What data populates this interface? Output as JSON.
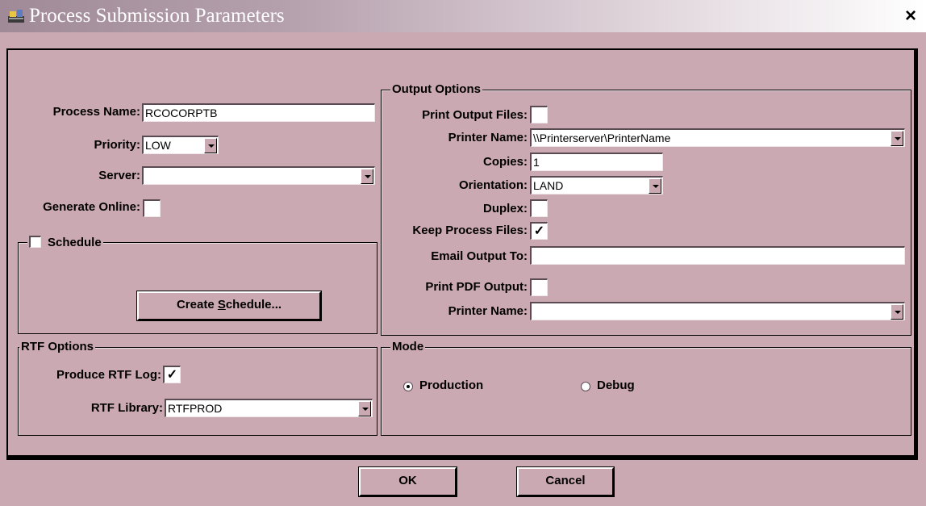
{
  "window": {
    "title": "Process Submission Parameters",
    "close_glyph": "×"
  },
  "process": {
    "name_label": "Process Name:",
    "name_value": "RCOCORPTB",
    "priority_label": "Priority:",
    "priority_value": "LOW",
    "server_label": "Server:",
    "server_value": "",
    "generate_online_label": "Generate Online:",
    "generate_online_checked": false
  },
  "schedule": {
    "label": "Schedule",
    "checked": false,
    "button_prefix": "Create ",
    "button_underline": "S",
    "button_suffix": "chedule..."
  },
  "rtf": {
    "group_title": "RTF Options",
    "log_label": "Produce RTF Log:",
    "log_mark": "✓",
    "library_label": "RTF Library:",
    "library_value": "RTFPROD"
  },
  "output": {
    "group_title": "Output Options",
    "print_files_label": "Print Output Files:",
    "print_files_mark": "",
    "printer_label": "Printer Name:",
    "printer_value": "\\\\Printerserver\\PrinterName",
    "copies_label": "Copies:",
    "copies_value": "1",
    "orientation_label": "Orientation:",
    "orientation_value": "LAND",
    "duplex_label": "Duplex:",
    "duplex_mark": "",
    "keep_files_label": "Keep Process Files:",
    "keep_files_mark": "✓",
    "email_label": "Email Output To:",
    "email_value": "",
    "pdf_label": "Print PDF Output:",
    "pdf_mark": "",
    "pdf_printer_label": "Printer Name:",
    "pdf_printer_value": ""
  },
  "mode": {
    "group_title": "Mode",
    "production_label": "Production",
    "debug_label": "Debug",
    "selected": "Production"
  },
  "actions": {
    "ok_label": "OK",
    "cancel_label": "Cancel"
  },
  "colors": {
    "face": "#cba9b3",
    "title_start": "#a08a98"
  },
  "icons": {
    "app": "app-icon",
    "close": "close-icon",
    "dropdown": "chevron-down-icon"
  }
}
